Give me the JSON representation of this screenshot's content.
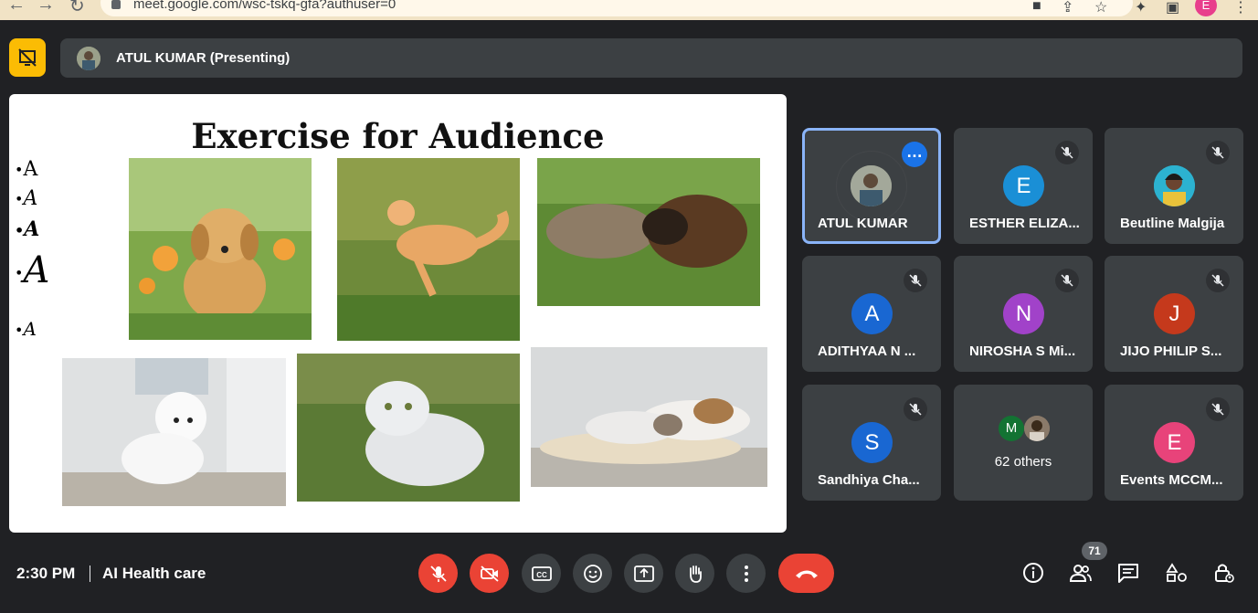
{
  "browser": {
    "url": "meet.google.com/wsc-tskq-gfa?authuser=0",
    "profile_initial": "E"
  },
  "presenter": {
    "label": "ATUL KUMAR (Presenting)"
  },
  "slide": {
    "title": "Exercise for Audience",
    "bullets": [
      "A",
      "A",
      "A",
      "A",
      "A"
    ]
  },
  "participants": [
    {
      "name": "ATUL KUMAR",
      "initial": "",
      "color": "#2e3236",
      "active": true,
      "muted": false
    },
    {
      "name": "ESTHER ELIZA...",
      "initial": "E",
      "color": "#1a8fd6",
      "active": false,
      "muted": true
    },
    {
      "name": "Beutline Malgija",
      "initial": "",
      "color": "#23a7c8",
      "active": false,
      "muted": true
    },
    {
      "name": "ADITHYAA N ...",
      "initial": "A",
      "color": "#1967d2",
      "active": false,
      "muted": true
    },
    {
      "name": "NIROSHA S Mi...",
      "initial": "N",
      "color": "#a142c9",
      "active": false,
      "muted": true
    },
    {
      "name": "JIJO PHILIP S...",
      "initial": "J",
      "color": "#c5391c",
      "active": false,
      "muted": true
    },
    {
      "name": "Sandhiya Cha...",
      "initial": "S",
      "color": "#1967d2",
      "active": false,
      "muted": true
    },
    {
      "name": "62 others",
      "initial": "M",
      "color": "#137333",
      "active": false,
      "muted": false
    },
    {
      "name": "Events MCCM...",
      "initial": "E",
      "color": "#e8437a",
      "active": false,
      "muted": true
    }
  ],
  "bottom": {
    "time": "2:30 PM",
    "meeting_name": "AI Health care",
    "people_count": "71"
  }
}
